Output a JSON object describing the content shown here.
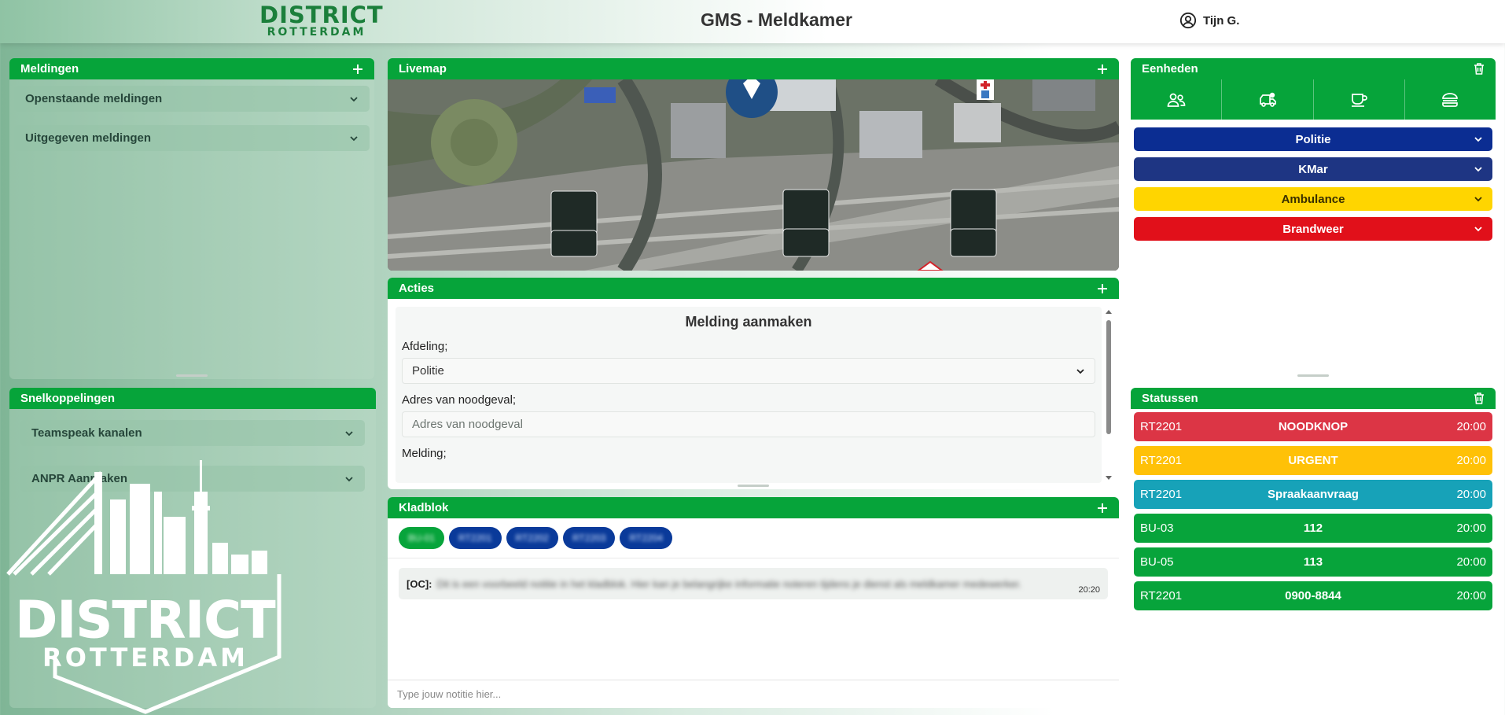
{
  "header": {
    "logo_line1": "DISTRICT",
    "logo_line2": "ROTTERDAM",
    "title": "GMS - Meldkamer",
    "user_name": "Tijn G."
  },
  "meldingen": {
    "title": "Meldingen",
    "items": [
      "Openstaande meldingen",
      "Uitgegeven meldingen"
    ]
  },
  "snelkoppelingen": {
    "title": "Snelkoppelingen",
    "items": [
      "Teamspeak kanalen",
      "ANPR Aanmaken"
    ]
  },
  "livemap": {
    "title": "Livemap"
  },
  "acties": {
    "title": "Acties",
    "form_title": "Melding aanmaken",
    "afdeling_label": "Afdeling;",
    "afdeling_value": "Politie",
    "adres_label": "Adres van noodgeval;",
    "adres_placeholder": "Adres van noodgeval",
    "melding_label": "Melding;"
  },
  "kladblok": {
    "title": "Kladblok",
    "chips": [
      {
        "label": "BU-01",
        "color": "#07a43b"
      },
      {
        "label": "RT2201",
        "color": "#0a3a9a"
      },
      {
        "label": "RT2202",
        "color": "#0a3a9a"
      },
      {
        "label": "RT2203",
        "color": "#0a3a9a"
      },
      {
        "label": "RT2204",
        "color": "#0a3a9a"
      }
    ],
    "note_author": "[OC]:",
    "note_text": "Dit is een voorbeeld notitie in het kladblok. Hier kan je belangrijke informatie noteren tijdens je dienst als meldkamer medewerker.",
    "note_time": "20:20",
    "input_placeholder": "Type jouw notitie hier..."
  },
  "eenheden": {
    "title": "Eenheden",
    "tab_icons": [
      "users-icon",
      "ambulance-icon",
      "coffee-icon",
      "burger-icon"
    ],
    "units": [
      {
        "label": "Politie",
        "color": "#0b2d92",
        "text": "#ffffff"
      },
      {
        "label": "KMar",
        "color": "#1e3583",
        "text": "#ffffff"
      },
      {
        "label": "Ambulance",
        "color": "#ffd500",
        "text": "#3a2f00"
      },
      {
        "label": "Brandweer",
        "color": "#e1101a",
        "text": "#ffffff"
      }
    ]
  },
  "statussen": {
    "title": "Statussen",
    "rows": [
      {
        "code": "RT2201",
        "message": "NOODKNOP",
        "time": "20:00",
        "color": "#dc3545"
      },
      {
        "code": "RT2201",
        "message": "URGENT",
        "time": "20:00",
        "color": "#ffc107"
      },
      {
        "code": "RT2201",
        "message": "Spraakaanvraag",
        "time": "20:00",
        "color": "#17a2b8"
      },
      {
        "code": "BU-03",
        "message": "112",
        "time": "20:00",
        "color": "#07a43b"
      },
      {
        "code": "BU-05",
        "message": "113",
        "time": "20:00",
        "color": "#07a43b"
      },
      {
        "code": "RT2201",
        "message": "0900-8844",
        "time": "20:00",
        "color": "#07a43b"
      }
    ]
  },
  "big_logo": {
    "line1": "DISTRICT",
    "line2": "ROTTERDAM"
  }
}
